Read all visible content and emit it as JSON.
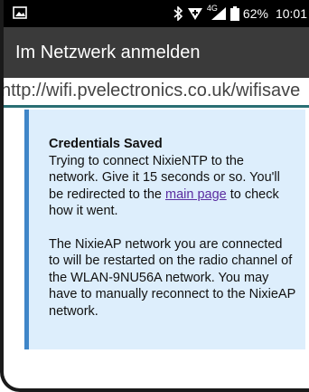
{
  "status_bar": {
    "battery_percent": "62%",
    "time": "10:01",
    "network_type": "4G",
    "icons": [
      "gallery-notification-icon",
      "bluetooth-icon",
      "data-saver-icon",
      "cellular-signal-icon",
      "battery-icon"
    ]
  },
  "app_bar": {
    "title": "Im Netzwerk anmelden"
  },
  "url_bar": {
    "url": "http://wifi.pvelectronics.co.uk/wifisave"
  },
  "notice": {
    "heading": "Credentials Saved",
    "para1_before_link": "Trying to connect NixieNTP to the network. Give it 15 seconds or so. You'll be redirected to the ",
    "link_text": "main page",
    "para1_after_link": " to check how it went.",
    "para2": "The NixieAP network you are connected to will be restarted on the radio channel of the WLAN-9NU56A network. You may have to manually reconnect to the NixieAP network."
  },
  "colors": {
    "status_bar_bg": "#000000",
    "app_bar_bg": "#3a3a3a",
    "url_underline": "#2a6f74",
    "notice_bg": "#ddeefc",
    "notice_border": "#3f86c8",
    "link": "#5a2ca0"
  }
}
